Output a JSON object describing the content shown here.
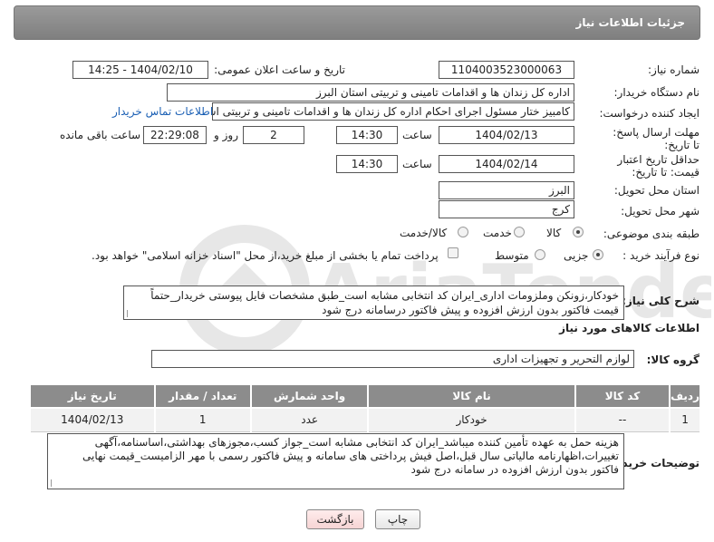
{
  "header": {
    "title": "جزئیات اطلاعات نیاز"
  },
  "fields": {
    "need_number_label": "شماره نیاز:",
    "need_number": "1104003523000063",
    "announce_label": "تاریخ و ساعت اعلان عمومی:",
    "announce_value": "1404/02/10 - 14:25",
    "buyer_org_label": "نام دستگاه خریدار:",
    "buyer_org": "اداره کل زندان ها و اقدامات تامینی و تربیتی استان البرز",
    "requester_label": "ایجاد کننده درخواست:",
    "requester": "کامبیز ختار مسئول اجرای احکام اداره کل زندان ها و اقدامات تامینی و تربیتی اس",
    "buyer_contact_link": "اطلاعات تماس خریدار",
    "reply_deadline_label": "مهلت ارسال پاسخ: تا تاریخ:",
    "reply_date": "1404/02/13",
    "time_label": "ساعت",
    "reply_time": "14:30",
    "days_value": "2",
    "days_label": "روز و",
    "remaining_time": "22:29:08",
    "remaining_label": "ساعت باقی مانده",
    "price_validity_label": "حداقل تاریخ اعتبار قیمت: تا تاریخ:",
    "price_date": "1404/02/14",
    "price_time": "14:30",
    "province_label": "استان محل تحویل:",
    "province": "البرز",
    "city_label": "شهر محل تحویل:",
    "city": "کرج",
    "category_label": "طبقه بندی موضوعی:",
    "category_options": [
      "کالا",
      "خدمت",
      "کالا/خدمت"
    ],
    "process_label": "نوع فرآیند خرید :",
    "process_options": [
      "جزیی",
      "متوسط"
    ],
    "payment_note": "پرداخت تمام یا بخشی از مبلغ خرید،از محل \"اسناد خزانه اسلامی\" خواهد بود.",
    "summary_label": "شرح کلی نیاز:",
    "summary": "خودکار،زونکن وملزومات اداری_ایران کد انتخابی مشابه است_طبق مشخصات فایل پیوستی خریدار_حتماً قیمت فاکتور بدون ارزش افزوده و پیش فاکتور درسامانه درج شود",
    "goods_info_title": "اطلاعات کالاهای مورد نیاز",
    "goods_group_label": "گروه کالا:",
    "goods_group": "لوازم التحریر و تجهیزات اداری",
    "buyer_notes_label": "توضیحات خریدار:",
    "buyer_notes": "هزینه حمل به عهده تأمین کننده میباشد_ایران کد انتخابی مشابه است_جواز کسب،مجوزهای بهداشتی،اساسنامه،آگهی تغییرات،اظهارنامه مالیاتی سال قبل،اصل فیش پرداختی های سامانه و پیش فاکتور رسمی با مهر الزامیست_قیمت نهایی فاکتور بدون ارزش افزوده در سامانه درج شود"
  },
  "table": {
    "headers": [
      "ردیف",
      "کد کالا",
      "نام کالا",
      "واحد شمارش",
      "تعداد / مقدار",
      "تاریخ نیاز"
    ],
    "rows": [
      [
        "1",
        "--",
        "خودکار",
        "عدد",
        "1",
        "1404/02/13"
      ]
    ]
  },
  "buttons": {
    "print": "چاپ",
    "back": "بازگشت"
  },
  "watermark_text": "AriaTender.neT"
}
